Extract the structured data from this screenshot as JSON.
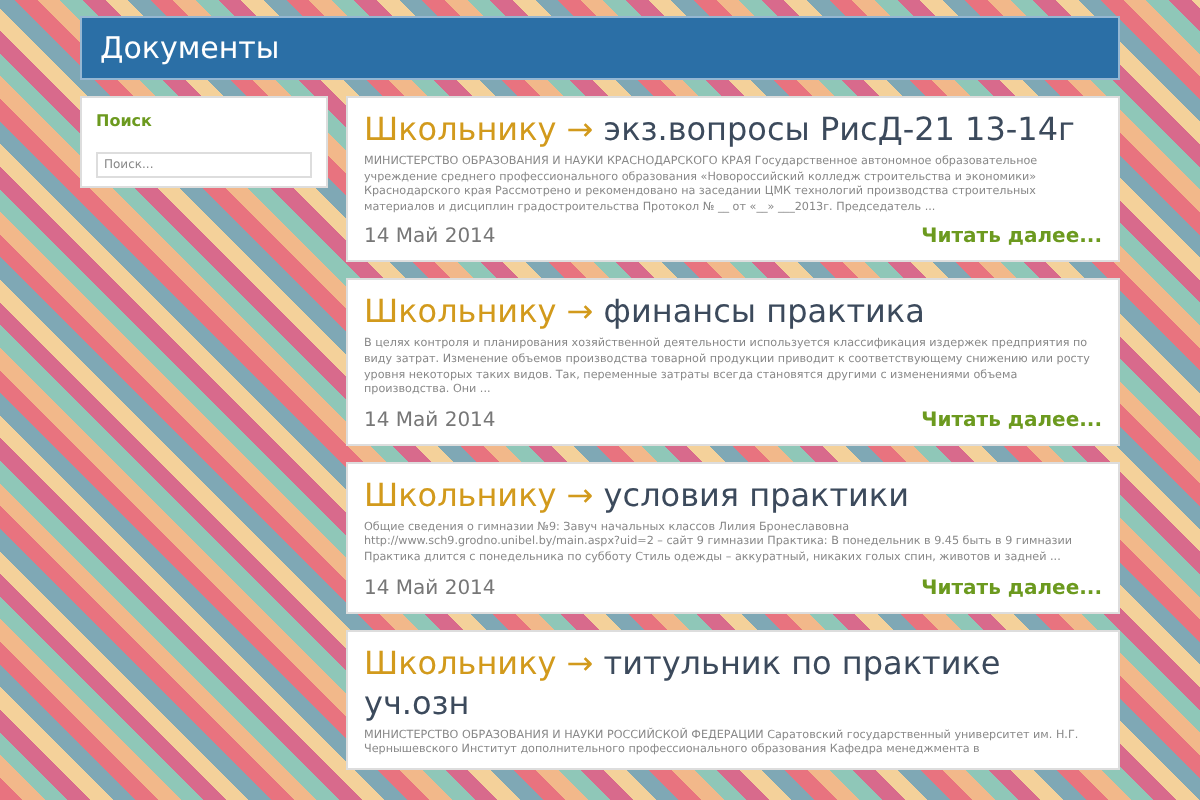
{
  "header": {
    "title": "Документы"
  },
  "sidebar": {
    "widget_title": "Поиск",
    "search": {
      "placeholder": "Поиск..."
    }
  },
  "posts": [
    {
      "category": "Школьнику",
      "arrow": "→",
      "title": "экз.вопросы РисД-21 13-14г",
      "excerpt": "МИНИСТЕРСТВО ОБРАЗОВАНИЯ И НАУКИ КРАСНОДАРСКОГО КРАЯ Государственное автономное образовательное учреждение среднего профессионального образования «Новороссийский колледж строительства и экономики» Краснодарского края Рассмотрено и рекомендовано на заседании ЦМК технологий производства строительных материалов и дисциплин градостроительства Протокол № __ от «__» ___2013г. Председатель ...",
      "date": "14 Май 2014",
      "more": "Читать далее..."
    },
    {
      "category": "Школьнику",
      "arrow": "→",
      "title": "финансы практика",
      "excerpt": "В целях контроля и планирования хозяйственной деятельности используется классификация издержек предприятия по виду затрат. Изменение объемов производства товарной продукции приводит к соответствующему снижению или росту уровня некоторых таких видов. Так, переменные затраты всегда становятся другими с изменениями объема производства. Они ...",
      "date": "14 Май 2014",
      "more": "Читать далее..."
    },
    {
      "category": "Школьнику",
      "arrow": "→",
      "title": "условия практики",
      "excerpt": "Общие сведения о гимназии №9: Завуч начальных классов Лилия Бронеславовна http://www.sch9.grodno.unibel.by/main.aspx?uid=2 – сайт 9 гимназии Практика: В понедельник в 9.45 быть в 9 гимназии Практика длится с понедельника по субботу Стиль одежды – аккуратный, никаких голых спин, животов и задней ...",
      "date": "14 Май 2014",
      "more": "Читать далее..."
    },
    {
      "category": "Школьнику",
      "arrow": "→",
      "title": "титульник по практике уч.озн",
      "excerpt": "МИНИСТЕРСТВО ОБРАЗОВАНИЯ И НАУКИ РОССИЙСКОЙ ФЕДЕРАЦИИ Саратовский государственный университет им. Н.Г. Чернышевского Институт дополнительного профессионального образования Кафедра менеджмента в"
    }
  ]
}
